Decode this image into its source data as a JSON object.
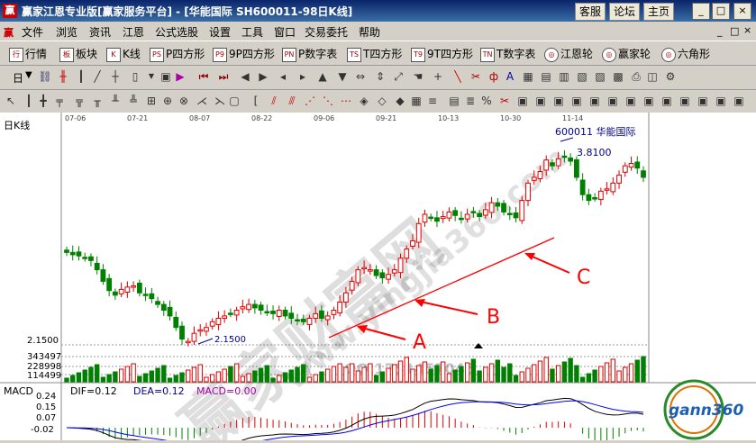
{
  "window": {
    "title": "赢家江恩专业版[赢家服务平台] - [华能国际   SH600011-98日K线]",
    "logo": "赢",
    "buttons": [
      "客服",
      "论坛",
      "主页"
    ]
  },
  "menu": [
    "文件",
    "浏览",
    "资讯",
    "江恩",
    "公式选股",
    "设置",
    "工具",
    "窗口",
    "交易委托",
    "帮助"
  ],
  "toolbar1": [
    {
      "icon": "行",
      "label": "行情"
    },
    {
      "icon": "板",
      "label": "板块"
    },
    {
      "icon": "K",
      "label": "K线"
    },
    {
      "icon": "PS",
      "label": "P四方形"
    },
    {
      "icon": "P9",
      "label": "9P四方形"
    },
    {
      "icon": "PN",
      "label": "P数字表"
    },
    {
      "icon": "TS",
      "label": "T四方形"
    },
    {
      "icon": "T9",
      "label": "9T四方形"
    },
    {
      "icon": "TN",
      "label": "T数字表"
    },
    {
      "icon": "◎",
      "label": "江恩轮"
    },
    {
      "icon": "◎",
      "label": "赢家轮"
    },
    {
      "icon": "◎",
      "label": "六角形"
    }
  ],
  "toolbar2": {
    "period": "日"
  },
  "chart": {
    "panel_label": "日K线",
    "dates": [
      "07-06",
      "07-21",
      "08-07",
      "08-22",
      "09-06",
      "09-21",
      "10-13",
      "10-30",
      "11-14"
    ],
    "stock_label": "600011 华能国际",
    "high_label": "3.8100",
    "low_label": "2.1500",
    "price_axis_label": "2.1500",
    "volume_ticks": [
      "343497",
      "228998",
      "114499"
    ],
    "annotations": [
      "A",
      "B",
      "C"
    ],
    "watermark_main": "赢家财富网",
    "watermark_url": "www.yingjia360.com",
    "watermark_qq": "QQ:1731457046",
    "macd": {
      "name": "MACD",
      "dif": "DIF=0.12",
      "dea": "DEA=0.12",
      "macd": "MACD=0.00",
      "ticks": [
        "0.24",
        "0.15",
        "0.07",
        "-0.02"
      ]
    },
    "logo": "gann360",
    "colors": {
      "up": "#e00000",
      "down": "#008000",
      "trend": "#ff0000",
      "dif": "#000000",
      "dea": "#0000ff"
    }
  },
  "chart_data": {
    "type": "candlestick",
    "symbol": "600011",
    "name": "华能国际",
    "x_ticks": [
      "07-06",
      "07-21",
      "08-07",
      "08-22",
      "09-06",
      "09-21",
      "10-13",
      "10-30",
      "11-14"
    ],
    "low": 2.15,
    "high": 3.81,
    "closes": [
      2.95,
      2.93,
      2.92,
      2.9,
      2.88,
      2.8,
      2.7,
      2.62,
      2.58,
      2.63,
      2.65,
      2.66,
      2.6,
      2.58,
      2.55,
      2.5,
      2.45,
      2.4,
      2.3,
      2.2,
      2.18,
      2.25,
      2.28,
      2.3,
      2.35,
      2.38,
      2.4,
      2.42,
      2.45,
      2.48,
      2.5,
      2.47,
      2.45,
      2.43,
      2.42,
      2.45,
      2.4,
      2.38,
      2.36,
      2.35,
      2.38,
      2.42,
      2.38,
      2.4,
      2.45,
      2.52,
      2.6,
      2.7,
      2.8,
      2.82,
      2.8,
      2.75,
      2.73,
      2.76,
      2.8,
      2.9,
      2.98,
      3.05,
      3.2,
      3.28,
      3.25,
      3.22,
      3.26,
      3.3,
      3.27,
      3.24,
      3.28,
      3.3,
      3.26,
      3.32,
      3.38,
      3.35,
      3.3,
      3.28,
      3.25,
      3.4,
      3.55,
      3.6,
      3.65,
      3.75,
      3.7,
      3.76,
      3.78,
      3.74,
      3.6,
      3.45,
      3.4,
      3.42,
      3.48,
      3.5,
      3.55,
      3.62,
      3.7,
      3.72,
      3.68,
      3.6
    ],
    "trendline": {
      "from_label": "A",
      "through": [
        "B",
        "C"
      ]
    }
  }
}
